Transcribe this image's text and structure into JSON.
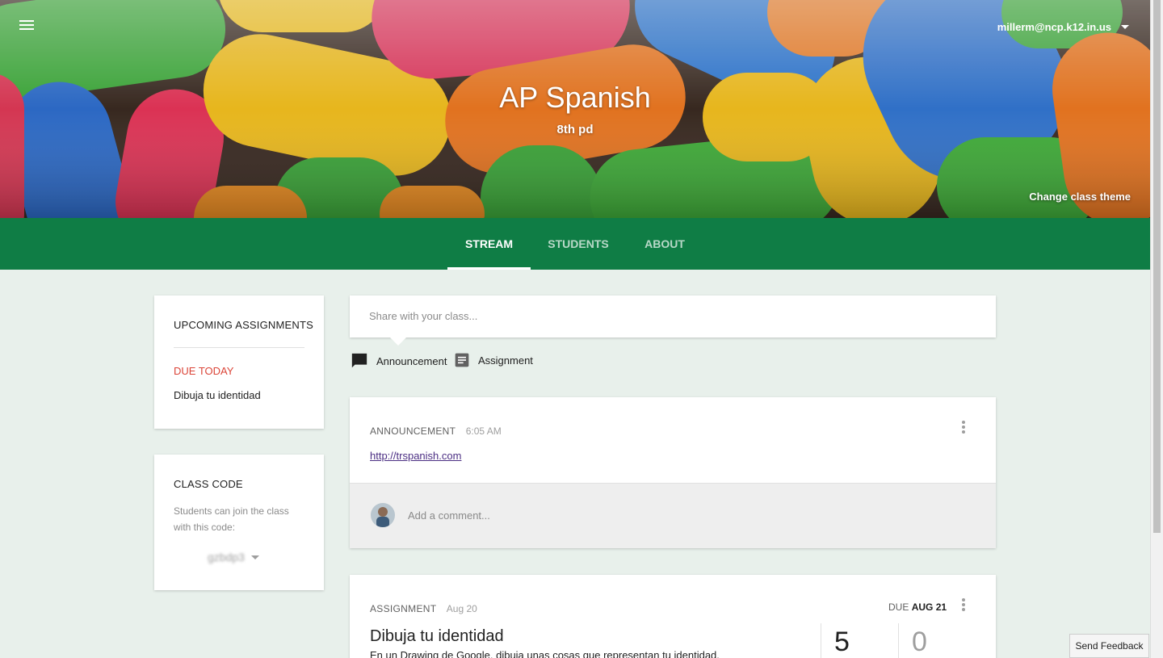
{
  "header": {
    "account_email": "millerm@ncp.k12.in.us",
    "class_name": "AP Spanish",
    "class_section": "8th pd",
    "change_theme_label": "Change class theme"
  },
  "tabs": [
    {
      "label": "STREAM",
      "active": true
    },
    {
      "label": "STUDENTS",
      "active": false
    },
    {
      "label": "ABOUT",
      "active": false
    }
  ],
  "upcoming": {
    "heading": "UPCOMING ASSIGNMENTS",
    "due_label": "DUE TODAY",
    "items": [
      "Dibuja tu identidad"
    ]
  },
  "class_code": {
    "heading": "CLASS CODE",
    "description": "Students can join the class with this code:",
    "code": "gzbdp3"
  },
  "share": {
    "placeholder": "Share with your class...",
    "announcement_label": "Announcement",
    "assignment_label": "Assignment"
  },
  "posts": [
    {
      "type": "ANNOUNCEMENT",
      "time": "6:05 AM",
      "link": "http://trspanish.com",
      "comment_placeholder": "Add a comment..."
    },
    {
      "type": "ASSIGNMENT",
      "time": "Aug 20",
      "due_prefix": "DUE",
      "due_date": "AUG 21",
      "title": "Dibuja tu identidad",
      "description": "En un Drawing de Google, dibuja unas cosas que representan tu identidad.",
      "done_count": "5",
      "not_done_count": "0"
    }
  ],
  "feedback_label": "Send Feedback",
  "colors": {
    "tab_bar": "#0f7d45",
    "background": "#e8f0eb",
    "due_today": "#db4437"
  }
}
